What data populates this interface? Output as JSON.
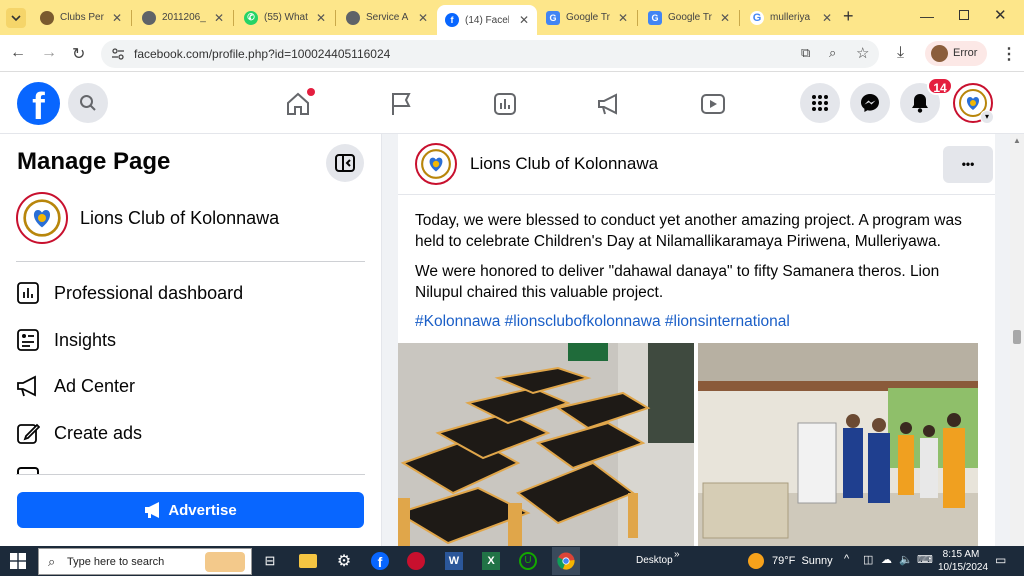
{
  "browser": {
    "tabs": [
      {
        "title": "Clubs Perf",
        "active": false
      },
      {
        "title": "2011206_",
        "active": false
      },
      {
        "title": "(55) What",
        "active": false
      },
      {
        "title": "Service A",
        "active": false
      },
      {
        "title": "(14) Faceb",
        "active": true
      },
      {
        "title": "Google Tr",
        "active": false
      },
      {
        "title": "Google Tr",
        "active": false
      },
      {
        "title": "mulleriya",
        "active": false
      }
    ],
    "new_tab": "+",
    "url": "facebook.com/profile.php?id=100024405116024",
    "profile_label": "Error"
  },
  "fb": {
    "notification_count": "14"
  },
  "sidebar": {
    "title": "Manage Page",
    "page_name": "Lions Club of Kolonnawa",
    "items": [
      {
        "label": "Professional dashboard"
      },
      {
        "label": "Insights"
      },
      {
        "label": "Ad Center"
      },
      {
        "label": "Create ads"
      }
    ],
    "advertise_label": "Advertise"
  },
  "post": {
    "author": "Lions Club of Kolonnawa",
    "more": "•••",
    "paragraph1": "Today, we were blessed to conduct yet another amazing project. A program was held to celebrate Children's Day at Nilamallikaramaya Piriwena, Mulleriyawa.",
    "paragraph2": "We were honored to deliver \"dahawal danaya\" to fifty Samanera theros. Lion Nilupul chaired this valuable project.",
    "hashtags": "#Kolonnawa #lionsclubofkolonnawa #lionsinternational"
  },
  "taskbar": {
    "search_placeholder": "Type here to search",
    "desktop_label": "Desktop",
    "weather": "79°F  Sunny",
    "time": "8:15 AM",
    "date": "10/15/2024"
  },
  "colors": {
    "fb_blue": "#0866ff",
    "tab_bar": "#fde68a",
    "taskbar": "#1c2a3a"
  }
}
